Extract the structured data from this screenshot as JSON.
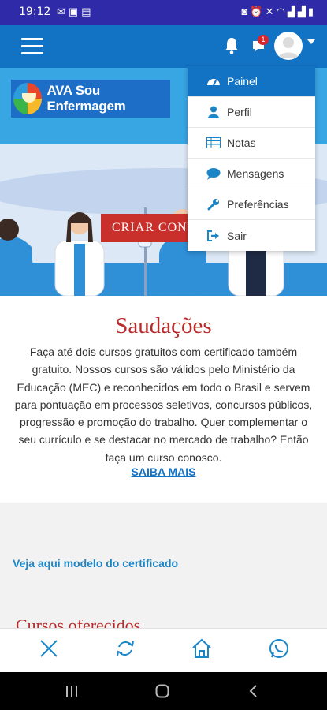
{
  "status_bar": {
    "time": "19:12",
    "left_icons": [
      "mail-icon",
      "image-icon",
      "sd-card-icon"
    ],
    "right_icons": [
      "nfc-icon",
      "alarm-icon",
      "mute-icon",
      "wifi-icon",
      "signal-icon",
      "signal-icon",
      "battery-icon"
    ]
  },
  "topnav": {
    "notifications_badge": "1"
  },
  "logo": {
    "title": "AVA Sou Enfermagem"
  },
  "hero": {
    "cta_label": "CRIAR CONTA"
  },
  "dropdown": {
    "items": [
      {
        "label": "Painel",
        "icon": "dashboard-icon"
      },
      {
        "label": "Perfil",
        "icon": "user-icon"
      },
      {
        "label": "Notas",
        "icon": "table-icon"
      },
      {
        "label": "Mensagens",
        "icon": "comment-icon"
      },
      {
        "label": "Preferências",
        "icon": "wrench-icon"
      },
      {
        "label": "Sair",
        "icon": "sign-out-icon"
      }
    ]
  },
  "welcome": {
    "heading": "Saudações",
    "body": "Faça até dois cursos gratuitos com certificado também gratuito. Nossos cursos são válidos pelo Ministério da Educação (MEC) e reconhecidos em todo o Brasil e servem para pontuação em processos seletivos, concursos públicos, progressão e promoção do trabalho. Quer complementar o seu currículo e se destacar no mercado de trabalho? Então faça um curso conosco.",
    "link": "SAIBA MAIS"
  },
  "certificate_link": "Veja aqui modelo do certificado",
  "partial_heading": "Cursos oferecidos",
  "bottom_bar": {
    "icons": [
      "close-icon",
      "refresh-icon",
      "home-icon",
      "whatsapp-icon"
    ]
  },
  "colors": {
    "status_bar": "#2e2aa8",
    "nav": "#1272c4",
    "hero_sky": "#39a6e4",
    "accent_red": "#c9302c",
    "link_blue": "#1a86c8"
  }
}
